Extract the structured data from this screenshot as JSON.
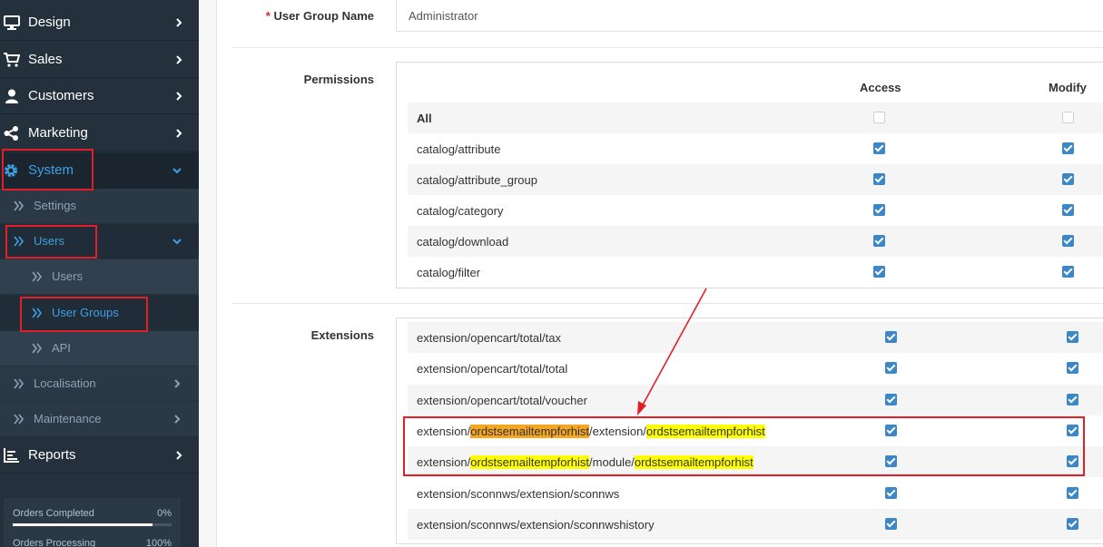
{
  "sidebar": {
    "nav": [
      {
        "label": "Design",
        "icon": "monitor-icon"
      },
      {
        "label": "Sales",
        "icon": "cart-icon"
      },
      {
        "label": "Customers",
        "icon": "user-icon"
      },
      {
        "label": "Marketing",
        "icon": "share-icon"
      },
      {
        "label": "System",
        "icon": "gear-icon"
      },
      {
        "label": "Reports",
        "icon": "bar-chart-icon"
      }
    ],
    "system_sub": [
      {
        "label": "Settings"
      },
      {
        "label": "Users"
      },
      {
        "label": "Localisation"
      },
      {
        "label": "Maintenance"
      }
    ],
    "users_sub": [
      {
        "label": "Users"
      },
      {
        "label": "User Groups"
      },
      {
        "label": "API"
      }
    ],
    "progress": [
      {
        "label": "Orders Completed",
        "value": "0%",
        "fraction": 0.88
      },
      {
        "label": "Orders Processing",
        "value": "100%"
      }
    ]
  },
  "form": {
    "group_name_label": "User Group Name",
    "required_mark": "*",
    "group_name_value": "Administrator",
    "permissions_label": "Permissions",
    "extensions_label": "Extensions",
    "access_header": "Access",
    "modify_header": "Modify",
    "permissions_rows": [
      {
        "label": "All",
        "access": false,
        "modify": false
      },
      {
        "label": "catalog/attribute",
        "access": true,
        "modify": true
      },
      {
        "label": "catalog/attribute_group",
        "access": true,
        "modify": true
      },
      {
        "label": "catalog/category",
        "access": true,
        "modify": true
      },
      {
        "label": "catalog/download",
        "access": true,
        "modify": true
      },
      {
        "label": "catalog/filter",
        "access": true,
        "modify": true
      }
    ],
    "extensions_rows": [
      {
        "label": "extension/opencart/total/tax"
      },
      {
        "label": "extension/opencart/total/total"
      },
      {
        "label": "extension/opencart/total/voucher"
      },
      {
        "p1": "extension/",
        "h1": "ordstsemailtempforhist",
        "p2": "/extension/",
        "h2": "ordstsemailtempforhist"
      },
      {
        "p1": "extension/",
        "h1": "ordstsemailtempforhist",
        "p2": "/module/",
        "h2": "ordstsemailtempforhist"
      },
      {
        "label": "extension/sconnws/extension/sconnws"
      },
      {
        "label": "extension/sconnws/extension/sconnwshistory"
      }
    ]
  },
  "colors": {
    "accent": "#3ea0e4",
    "annotation": "#e41e26",
    "sidebar": "#24303c"
  }
}
